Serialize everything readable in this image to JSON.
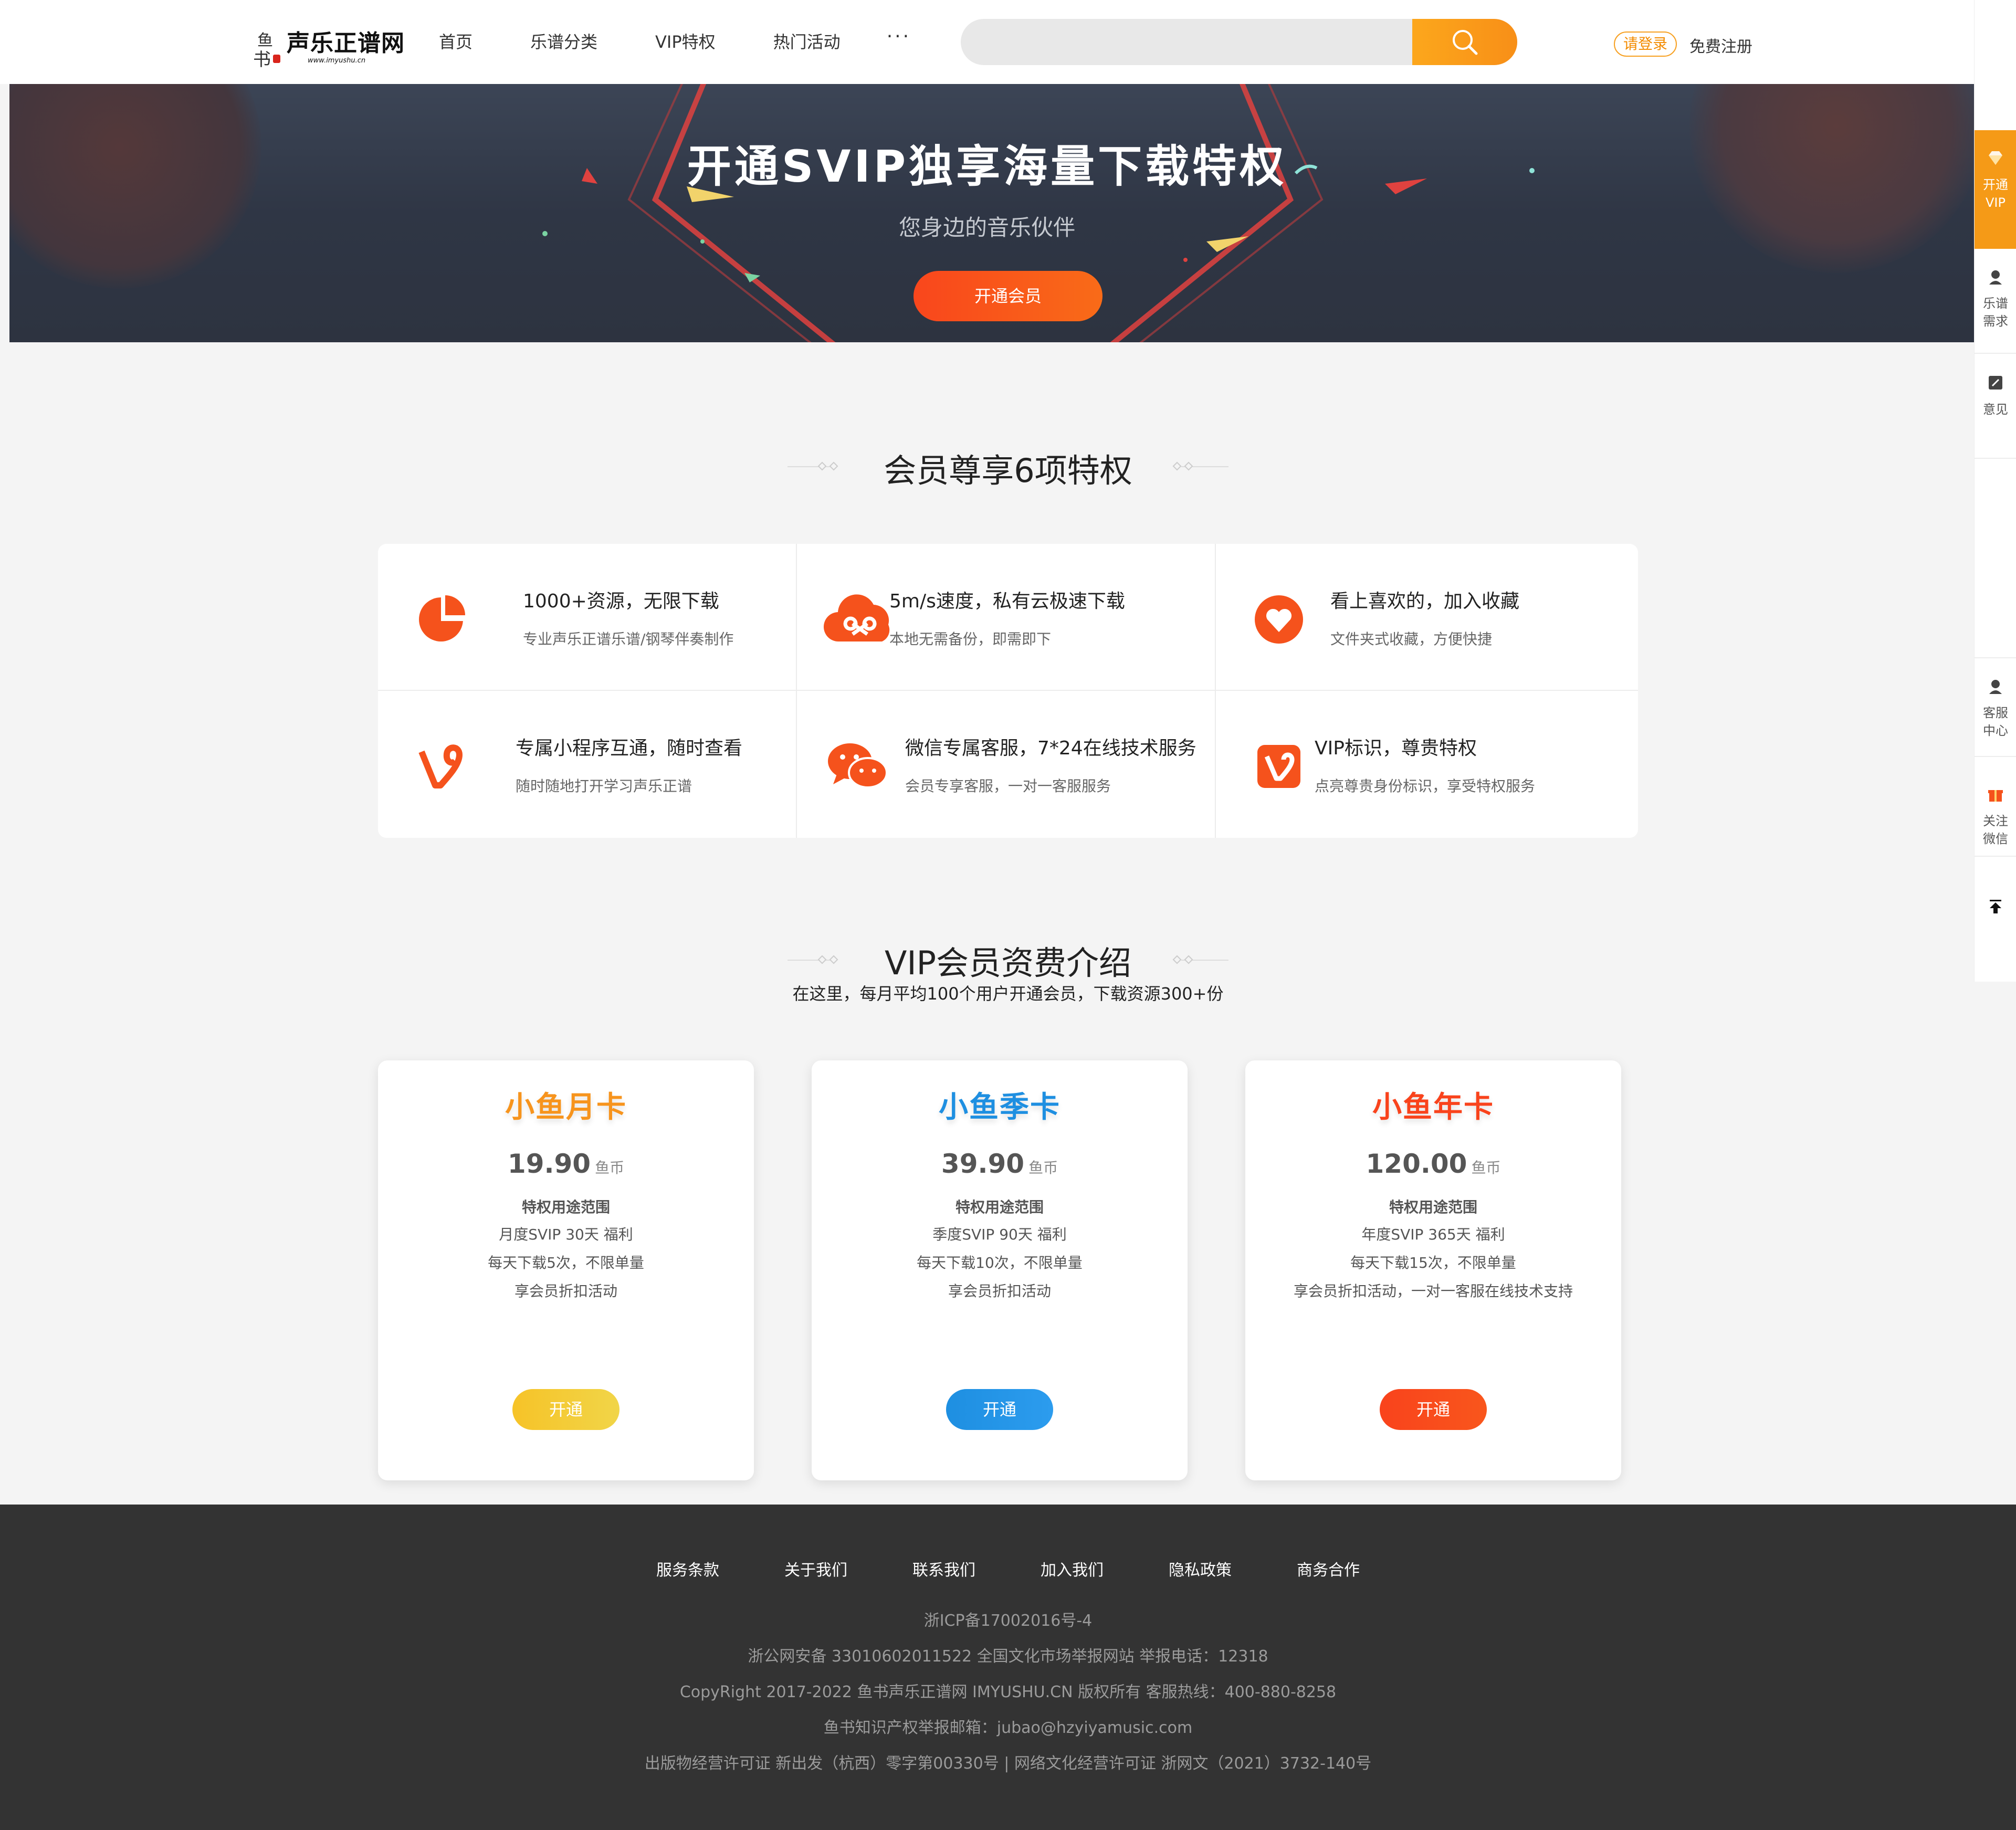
{
  "header": {
    "logo_text": "声乐正谱网",
    "logo_url": "www.imyushu.cn",
    "logo_seal_top": "鱼",
    "logo_seal_bottom": "书",
    "nav": [
      "首页",
      "乐谱分类",
      "VIP特权",
      "热门活动"
    ],
    "more": "···",
    "search_placeholder": "",
    "login": "请登录",
    "register": "免费注册"
  },
  "banner": {
    "title": "开通SVIP独享海量下载特权",
    "subtitle": "您身边的音乐伙伴",
    "button": "开通会员"
  },
  "sidebar": {
    "vip": [
      "开通",
      "VIP"
    ],
    "request": [
      "乐谱",
      "需求"
    ],
    "feedback": "意见",
    "service": [
      "客服",
      "中心"
    ],
    "wechat": [
      "关注",
      "微信"
    ]
  },
  "privileges": {
    "title": "会员尊享6项特权",
    "items": [
      {
        "title": "1000+资源，无限下载",
        "desc": "专业声乐正谱乐谱/钢琴伴奏制作",
        "icon": "pie-chart-icon"
      },
      {
        "title": "5m/s速度，私有云极速下载",
        "desc": "本地无需备份，即需即下",
        "icon": "cloud-icon"
      },
      {
        "title": "看上喜欢的，加入收藏",
        "desc": "文件夹式收藏，方便快捷",
        "icon": "heart-icon"
      },
      {
        "title": "专属小程序互通，随时查看",
        "desc": "随时随地打开学习声乐正谱",
        "icon": "vine-icon"
      },
      {
        "title": "微信专属客服，7*24在线技术服务",
        "desc": "会员专享客服，一对一客服服务",
        "icon": "wechat-icon"
      },
      {
        "title": "VIP标识，尊贵特权",
        "desc": "点亮尊贵身份标识，享受特权服务",
        "icon": "v-badge-icon"
      }
    ]
  },
  "pricing": {
    "title": "VIP会员资费介绍",
    "subtitle": "在这里，每月平均100个用户开通会员，下载资源300+份",
    "cards": [
      {
        "name": "小鱼月卡",
        "price": "19.90",
        "unit": "鱼币",
        "scope": "特权用途范围",
        "lines": [
          "月度SVIP 30天 福利",
          "每天下载5次，不限单量",
          "享会员折扣活动"
        ],
        "button": "开通",
        "color": "#f7941d"
      },
      {
        "name": "小鱼季卡",
        "price": "39.90",
        "unit": "鱼币",
        "scope": "特权用途范围",
        "lines": [
          "季度SVIP 90天 福利",
          "每天下载10次，不限单量",
          "享会员折扣活动"
        ],
        "button": "开通",
        "color": "#1e8fe1"
      },
      {
        "name": "小鱼年卡",
        "price": "120.00",
        "unit": "鱼币",
        "scope": "特权用途范围",
        "lines": [
          "年度SVIP 365天 福利",
          "每天下载15次，不限单量",
          "享会员折扣活动，一对一客服在线技术支持"
        ],
        "button": "开通",
        "color": "#f9431c"
      }
    ]
  },
  "footer": {
    "links": [
      "服务条款",
      "关于我们",
      "联系我们",
      "加入我们",
      "隐私政策",
      "商务合作"
    ],
    "lines": [
      "浙ICP备17002016号-4",
      "浙公网安备 33010602011522 全国文化市场举报网站 举报电话：12318",
      "CopyRight  2017-2022 鱼书声乐正谱网 IMYUSHU.CN 版权所有 客服热线：400-880-8258",
      "鱼书知识产权举报邮箱：jubao@hzyiyamusic.com",
      "出版物经营许可证 新出发（杭西）零字第00330号 | 网络文化经营许可证 浙网文（2021）3732-140号"
    ]
  },
  "colors": {
    "accent_orange": "#f7941d",
    "banner_button": "#f9461c",
    "icon_orange": "#f5521c",
    "footer_bg": "#333333"
  }
}
